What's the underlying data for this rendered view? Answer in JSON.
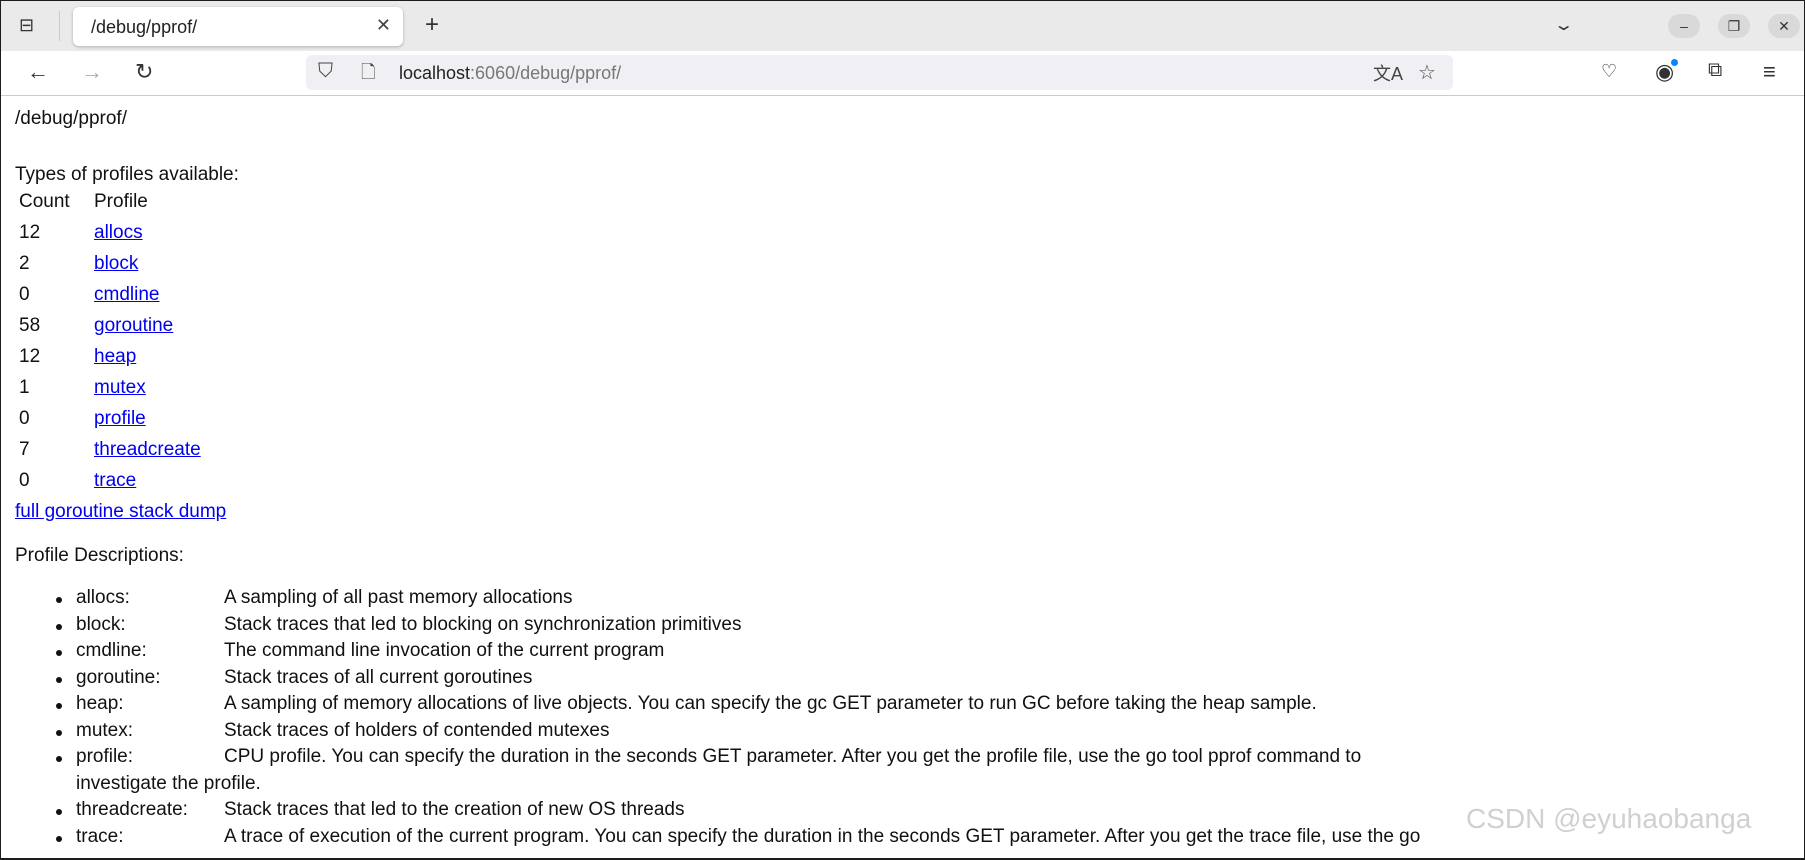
{
  "browser": {
    "tab_title": "/debug/pprof/",
    "url_host": "localhost",
    "url_rest": ":6060/debug/pprof/"
  },
  "page": {
    "title": "/debug/pprof/",
    "types_heading": "Types of profiles available:",
    "table_headers": [
      "Count",
      "Profile"
    ],
    "profiles": [
      {
        "count": "12",
        "name": "allocs"
      },
      {
        "count": "2",
        "name": "block"
      },
      {
        "count": "0",
        "name": "cmdline"
      },
      {
        "count": "58",
        "name": "goroutine"
      },
      {
        "count": "12",
        "name": "heap"
      },
      {
        "count": "1",
        "name": "mutex"
      },
      {
        "count": "0",
        "name": "profile"
      },
      {
        "count": "7",
        "name": "threadcreate"
      },
      {
        "count": "0",
        "name": "trace"
      }
    ],
    "full_dump_link": "full goroutine stack dump",
    "descriptions_heading": "Profile Descriptions:",
    "descriptions": [
      {
        "label": "allocs:",
        "text": "A sampling of all past memory allocations"
      },
      {
        "label": "block:",
        "text": "Stack traces that led to blocking on synchronization primitives"
      },
      {
        "label": "cmdline:",
        "text": "The command line invocation of the current program"
      },
      {
        "label": "goroutine:",
        "text": "Stack traces of all current goroutines"
      },
      {
        "label": "heap:",
        "text": "A sampling of memory allocations of live objects. You can specify the gc GET parameter to run GC before taking the heap sample."
      },
      {
        "label": "mutex:",
        "text": "Stack traces of holders of contended mutexes"
      },
      {
        "label": "profile:",
        "text": "CPU profile. You can specify the duration in the seconds GET parameter. After you get the profile file, use the go tool pprof command to",
        "cont": "investigate the profile."
      },
      {
        "label": "threadcreate:",
        "text": "Stack traces that led to the creation of new OS threads"
      },
      {
        "label": "trace:",
        "text": "A trace of execution of the current program. You can specify the duration in the seconds GET parameter. After you get the trace file, use the go"
      }
    ]
  },
  "watermark": "CSDN @eyuhaobanga"
}
